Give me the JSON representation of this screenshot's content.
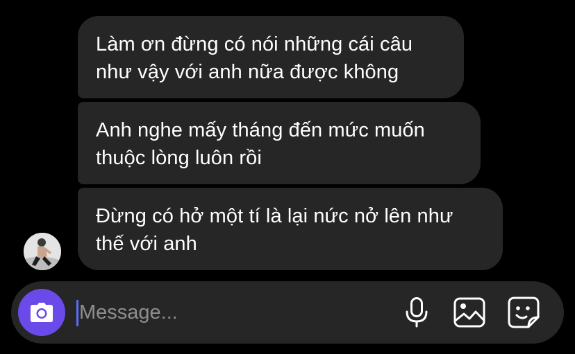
{
  "messages": [
    {
      "text": "Làm ơn đừng có nói những cái câu\nnhư vậy với anh nữa được không"
    },
    {
      "text": "Anh nghe mấy tháng đến mức muốn\nthuộc lòng luôn rồi"
    },
    {
      "text": "Đừng có hở một tí là lại nức nở lên như\nthế với anh"
    }
  ],
  "composer": {
    "placeholder": "Message...",
    "icons": {
      "camera": "camera-icon",
      "microphone": "microphone-icon",
      "gallery": "gallery-icon",
      "sticker": "sticker-icon"
    }
  },
  "colors": {
    "background": "#000000",
    "bubble": "#262626",
    "accent": "#6a4bea",
    "caret": "#5b6cff",
    "placeholder": "#8e8e8e"
  }
}
